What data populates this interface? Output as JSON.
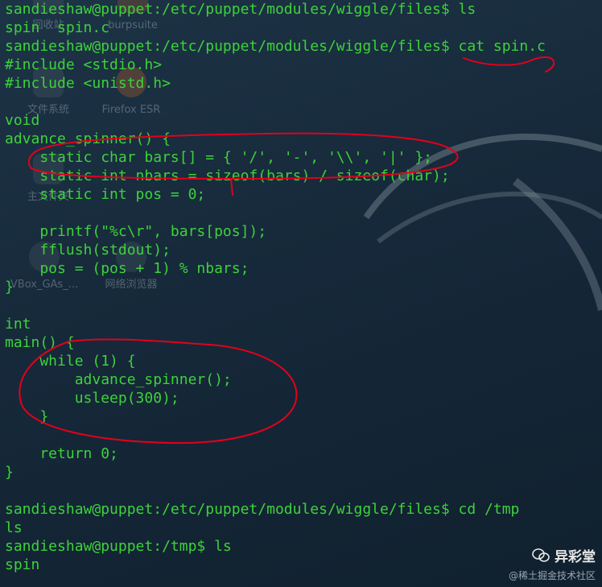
{
  "desktop": {
    "icons": [
      "回收站",
      "burpsuite",
      "文件系统",
      "Firefox ESR",
      "主文件夹",
      "VBox_GAs_...",
      "网络浏览器"
    ]
  },
  "terminal": {
    "lines": [
      "sandieshaw@puppet:/etc/puppet/modules/wiggle/files$ ls",
      "spin  spin.c",
      "sandieshaw@puppet:/etc/puppet/modules/wiggle/files$ cat spin.c",
      "#include <stdio.h>",
      "#include <unistd.h>",
      "",
      "void",
      "advance_spinner() {",
      "    static char bars[] = { '/', '-', '\\\\', '|' };",
      "    static int nbars = sizeof(bars) / sizeof(char);",
      "    static int pos = 0;",
      "",
      "    printf(\"%c\\r\", bars[pos]);",
      "    fflush(stdout);",
      "    pos = (pos + 1) % nbars;",
      "}",
      "",
      "int",
      "main() {",
      "    while (1) {",
      "        advance_spinner();",
      "        usleep(300);",
      "    }",
      "",
      "    return 0;",
      "}",
      "",
      "sandieshaw@puppet:/etc/puppet/modules/wiggle/files$ cd /tmp",
      "ls",
      "sandieshaw@puppet:/tmp$ ls",
      "spin"
    ]
  },
  "annotation_color": "#e3001b",
  "watermark": {
    "brand": "异彩堂",
    "source": "@稀土掘金技术社区"
  }
}
